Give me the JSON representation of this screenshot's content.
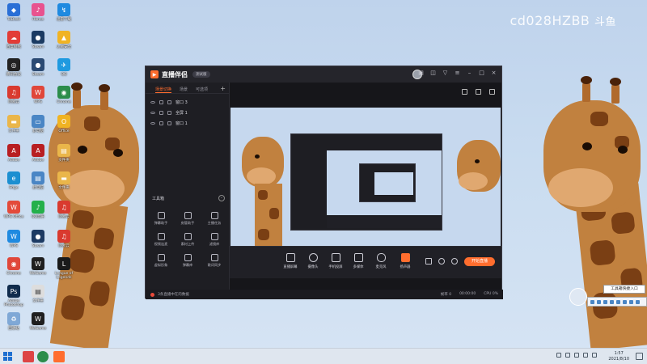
{
  "watermark": {
    "text": "cd028HZBB",
    "brand": "斗鱼"
  },
  "desktop": {
    "icons": [
      {
        "label": "ToDesk",
        "color": "#2a6fd6"
      },
      {
        "label": "iTunes",
        "color": "#e8538f"
      },
      {
        "label": "迅雷下载",
        "color": "#1f8ae0"
      },
      {
        "label": "百度网盘",
        "color": "#e23c37"
      },
      {
        "label": "Steam",
        "color": "#1b3b63"
      },
      {
        "label": "火绒安全",
        "color": "#f0b323"
      },
      {
        "label": "腾讯会议",
        "color": "#222222"
      },
      {
        "label": "Steam",
        "color": "#2b4a73"
      },
      {
        "label": "QQ",
        "color": "#1f9ae0"
      },
      {
        "label": "网易云",
        "color": "#d93a2f"
      },
      {
        "label": "WPS",
        "color": "#e0473a"
      },
      {
        "label": "Chrome",
        "color": "#2c8d4b"
      },
      {
        "label": "Adobe",
        "color": "#b81f22"
      },
      {
        "label": "Edge",
        "color": "#1b8fd1"
      },
      {
        "label": "WPS Office",
        "color": "#e34a3a"
      },
      {
        "label": "Steam",
        "color": "#1d3b64"
      },
      {
        "label": "QQ音乐",
        "color": "#24b04b"
      },
      {
        "label": "Adobe Photoshop",
        "color": "#0f2b4c"
      },
      {
        "label": "WeGame",
        "color": "#1f1f1f"
      },
      {
        "label": "League of Legends",
        "color": "#1a1a1a"
      },
      {
        "label": "Office",
        "color": "#f0b323"
      },
      {
        "label": "此电脑",
        "color": "#4a86c5"
      },
      {
        "label": "文件夹",
        "color": "#eab64a"
      },
      {
        "label": "回收站",
        "color": "#7fa8d6"
      }
    ]
  },
  "app": {
    "name": "直播伴侣",
    "version": "测试版",
    "scene_tabs": [
      "场景切换",
      "场景",
      "可选项"
    ],
    "sources": [
      {
        "label": "窗口 3"
      },
      {
        "label": "全屏 1"
      },
      {
        "label": "窗口 1"
      }
    ],
    "toolbox_title": "工具箱",
    "tools": [
      {
        "label": "弹幕助手"
      },
      {
        "label": "房管助手"
      },
      {
        "label": "主播任务"
      },
      {
        "label": "视频连麦"
      },
      {
        "label": "素材上传"
      },
      {
        "label": "滤镜库"
      },
      {
        "label": "虚拟形象"
      },
      {
        "label": "弹幕库"
      },
      {
        "label": "歌词同步"
      }
    ],
    "bottom_buttons": [
      {
        "label": "直播屏幕"
      },
      {
        "label": "摄像头"
      },
      {
        "label": "手机投屏"
      },
      {
        "label": "多媒体"
      },
      {
        "label": "麦克风"
      },
      {
        "label": "扬声器"
      }
    ],
    "go_live_label": "开始直播",
    "status_text": "3条直播中在的数据",
    "stats": [
      "帧率 0",
      "00:00:00",
      "CPU 0%"
    ]
  },
  "tray": {
    "tooltip": "工具箱快捷入口"
  },
  "taskbar": {
    "time": "1:57",
    "date": "2021/8/10"
  }
}
